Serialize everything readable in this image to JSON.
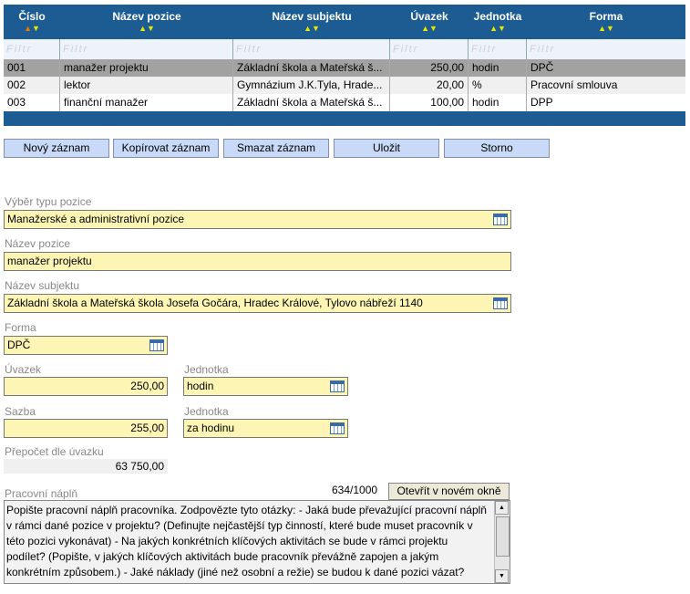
{
  "grid": {
    "headers": [
      {
        "label": "Číslo",
        "sort_active": true
      },
      {
        "label": "Název pozice",
        "sort_active": false
      },
      {
        "label": "Název subjektu",
        "sort_active": false
      },
      {
        "label": "Úvazek",
        "sort_active": false
      },
      {
        "label": "Jednotka",
        "sort_active": false
      },
      {
        "label": "Forma",
        "sort_active": false
      }
    ],
    "filter_placeholder": "Filtr",
    "rows": [
      {
        "cislo": "001",
        "nazev": "manažer projektu",
        "subjekt": "Základní škola a Mateřská š...",
        "uvazek": "250,00",
        "jednotka": "hodin",
        "forma": "DPČ",
        "selected": true
      },
      {
        "cislo": "002",
        "nazev": "lektor",
        "subjekt": "Gymnázium J.K.Tyla, Hrade...",
        "uvazek": "20,00",
        "jednotka": "%",
        "forma": "Pracovní smlouva",
        "selected": false
      },
      {
        "cislo": "003",
        "nazev": "finanční manažer",
        "subjekt": "Základní škola a Mateřská š...",
        "uvazek": "100,00",
        "jednotka": "hodin",
        "forma": "DPP",
        "selected": false
      }
    ]
  },
  "toolbar": {
    "new": "Nový záznam",
    "copy": "Kopírovat záznam",
    "delete": "Smazat záznam",
    "save": "Uložit",
    "cancel": "Storno"
  },
  "form": {
    "typ_label": "Výběr typu pozice",
    "typ_value": "Manažerské a administrativní pozice",
    "nazev_label": "Název pozice",
    "nazev_value": "manažer projektu",
    "subjekt_label": "Název subjektu",
    "subjekt_value": "Základní škola a Mateřská škola Josefa Gočára, Hradec Králové, Tylovo nábřeží 1140",
    "forma_label": "Forma",
    "forma_value": "DPČ",
    "uvazek_label": "Úvazek",
    "uvazek_value": "250,00",
    "jednotka1_label": "Jednotka",
    "jednotka1_value": "hodin",
    "sazba_label": "Sazba",
    "sazba_value": "255,00",
    "jednotka2_label": "Jednotka",
    "jednotka2_value": "za hodinu",
    "prepocet_label": "Přepočet dle úvazku",
    "prepocet_value": "63 750,00",
    "napln_label": "Pracovní náplň",
    "napln_count": "634/1000",
    "open_window": "Otevřít v novém okně",
    "napln_text": "Popište pracovní náplň pracovníka. Zodpovězte tyto otázky: - Jaká bude převažující pracovní náplň v rámci dané pozice v projektu? (Definujte nejčastější typ činností, které bude muset pracovník v této pozici vykonávat) - Na jakých konkrétních klíčových aktivitách se bude v rámci projektu podílet? (Popište, v jakých klíčových aktivitách bude pracovník převážně zapojen a jakým konkrétním způsobem.) - Jaké náklady (jiné než osobní a režie) se budou k dané pozici vázat? (Pokud je to relevantní, uveďte, zda se k výkonu dané pozice budou"
  }
}
